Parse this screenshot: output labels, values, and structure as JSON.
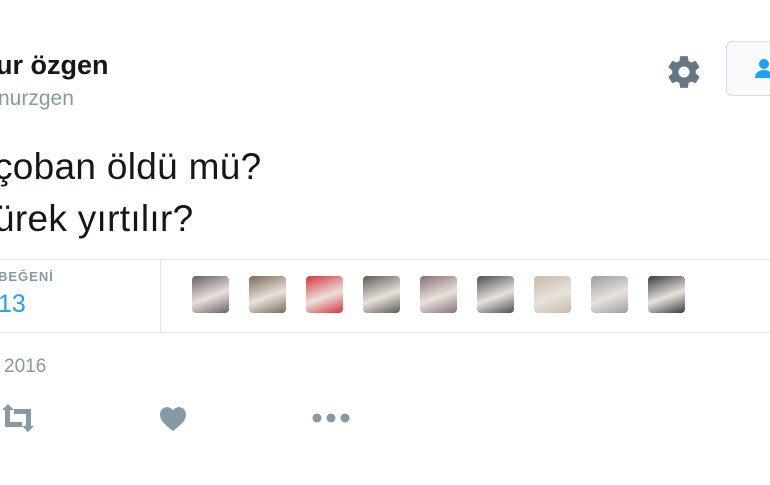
{
  "tweet": {
    "author_name": "ur özgen",
    "author_handle": "nurzgen",
    "text_line1": "çoban öldü mü?",
    "text_line2": "ürek yırtılır?",
    "likes_label": "BEĞENİ",
    "likes_count": "13",
    "date": "2016"
  },
  "likers": [
    {
      "name": "liker-1",
      "color": "#6b5d62"
    },
    {
      "name": "liker-2",
      "color": "#7a6a58"
    },
    {
      "name": "liker-3",
      "color": "#d9323c"
    },
    {
      "name": "liker-4",
      "color": "#5e5a55"
    },
    {
      "name": "liker-5",
      "color": "#8a6e74"
    },
    {
      "name": "liker-6",
      "color": "#4f4d50"
    },
    {
      "name": "liker-7",
      "color": "#c9b9a7"
    },
    {
      "name": "liker-8",
      "color": "#9a9da2"
    },
    {
      "name": "liker-9",
      "color": "#3b3a3f"
    }
  ],
  "icons": {
    "settings": "gear-icon",
    "follow": "follow-user-icon",
    "retweet": "retweet-icon",
    "like": "heart-icon",
    "more": "more-icon"
  },
  "colors": {
    "accent": "#1da1f2",
    "muted": "#8899a6",
    "text": "#14171a",
    "border": "#e1e8ed"
  }
}
